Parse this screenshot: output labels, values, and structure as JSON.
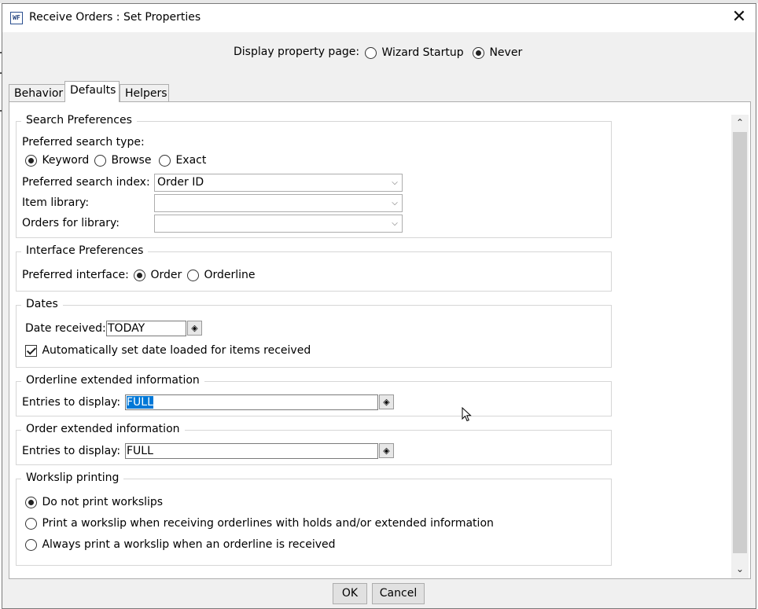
{
  "window": {
    "title": "Receive Orders : Set Properties",
    "icon_label": "WF",
    "close_glyph": "✕"
  },
  "display_property": {
    "label": "Display property page:",
    "options": [
      {
        "label": "Wizard Startup",
        "checked": false
      },
      {
        "label": "Never",
        "checked": true
      }
    ]
  },
  "tabs": [
    {
      "label": "Behavior",
      "active": false
    },
    {
      "label": "Defaults",
      "active": true
    },
    {
      "label": "Helpers",
      "active": false
    }
  ],
  "search_preferences": {
    "legend": "Search Preferences",
    "type_label": "Preferred search type:",
    "types": [
      {
        "label": "Keyword",
        "checked": true
      },
      {
        "label": "Browse",
        "checked": false
      },
      {
        "label": "Exact",
        "checked": false
      }
    ],
    "index_label": "Preferred search index:",
    "index_value": "Order ID",
    "item_library_label": "Item library:",
    "item_library_value": "",
    "orders_library_label": "Orders for library:",
    "orders_library_value": ""
  },
  "interface_preferences": {
    "legend": "Interface Preferences",
    "label": "Preferred interface:",
    "options": [
      {
        "label": "Order",
        "checked": true
      },
      {
        "label": "Orderline",
        "checked": false
      }
    ]
  },
  "dates": {
    "legend": "Dates",
    "received_label": "Date received:",
    "received_value": "TODAY",
    "auto_label": "Automatically set date loaded for items received",
    "auto_checked": true
  },
  "orderline_extended": {
    "legend": "Orderline extended information",
    "entries_label": "Entries to display:",
    "entries_value": "FULL"
  },
  "order_extended": {
    "legend": "Order extended information",
    "entries_label": "Entries to display:",
    "entries_value": "FULL"
  },
  "workslip": {
    "legend": "Workslip printing",
    "options": [
      {
        "label": "Do not print workslips",
        "checked": true
      },
      {
        "label": "Print a workslip when receiving orderlines with holds and/or extended information",
        "checked": false
      },
      {
        "label": "Always print a workslip when an orderline is received",
        "checked": false
      }
    ]
  },
  "buttons": {
    "ok": "OK",
    "cancel": "Cancel"
  },
  "colors": {
    "selection": "#0078d7",
    "dialog_bg": "#f0f0f0"
  }
}
